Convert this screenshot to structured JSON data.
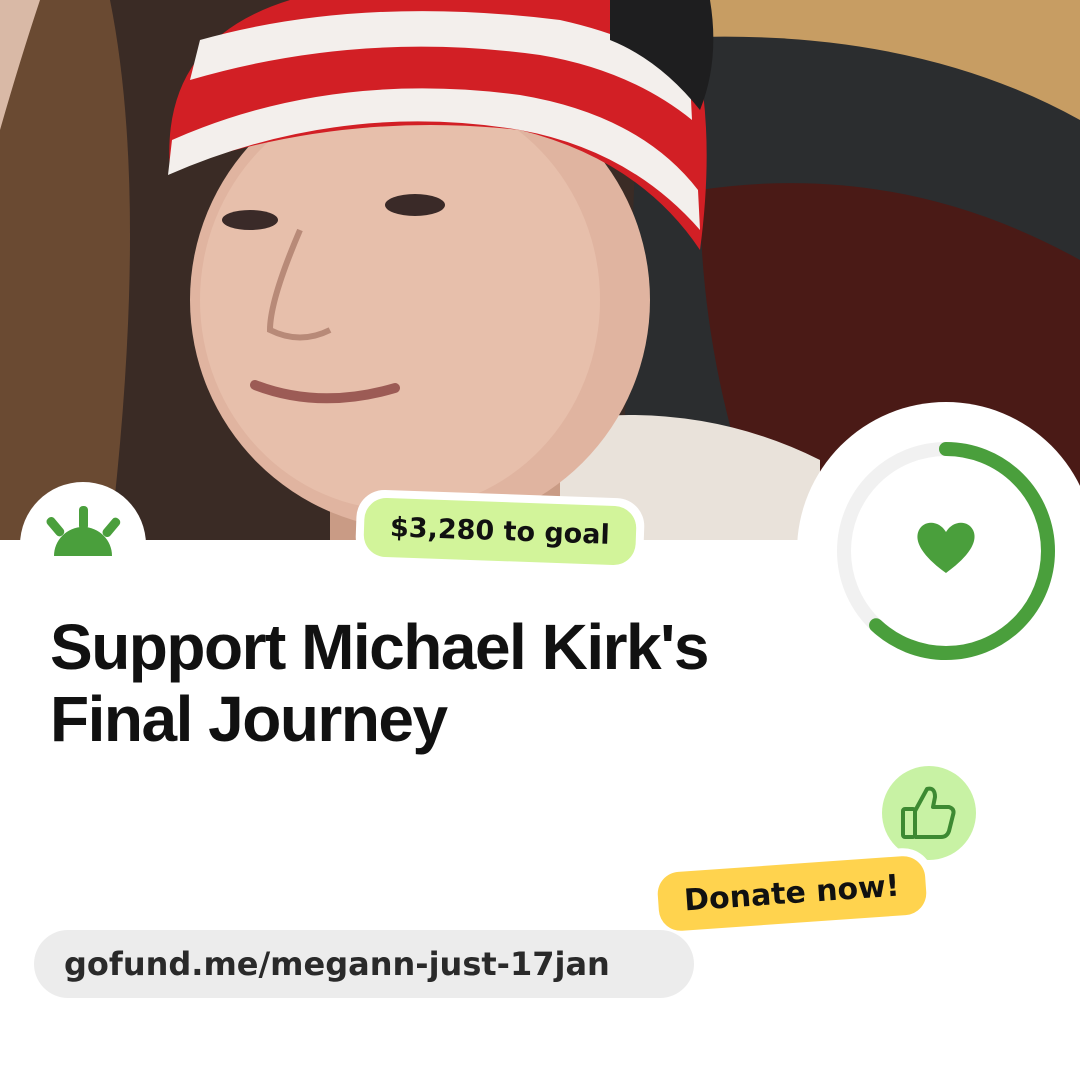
{
  "brand": {
    "logo_icon": "gofundme-sunrise-icon",
    "accent": "#4a9f3c"
  },
  "photo": {
    "subject_icon": "campaign-photo"
  },
  "progress": {
    "fraction_raised": 0.62,
    "icon": "heart-icon",
    "ring_color": "#4a9f3c",
    "track_color": "#f1f1f1"
  },
  "goal_badge": {
    "text": "$3,280 to goal",
    "bg": "#d2f49a"
  },
  "campaign": {
    "title": "Support Michael Kirk's Final Journey"
  },
  "cta": {
    "label": "Donate now!",
    "bg": "#ffd34e",
    "icon": "thumbs-up-icon",
    "icon_bg": "#c8f2a4"
  },
  "link": {
    "url": "gofund.me/megann-just-17jan"
  }
}
